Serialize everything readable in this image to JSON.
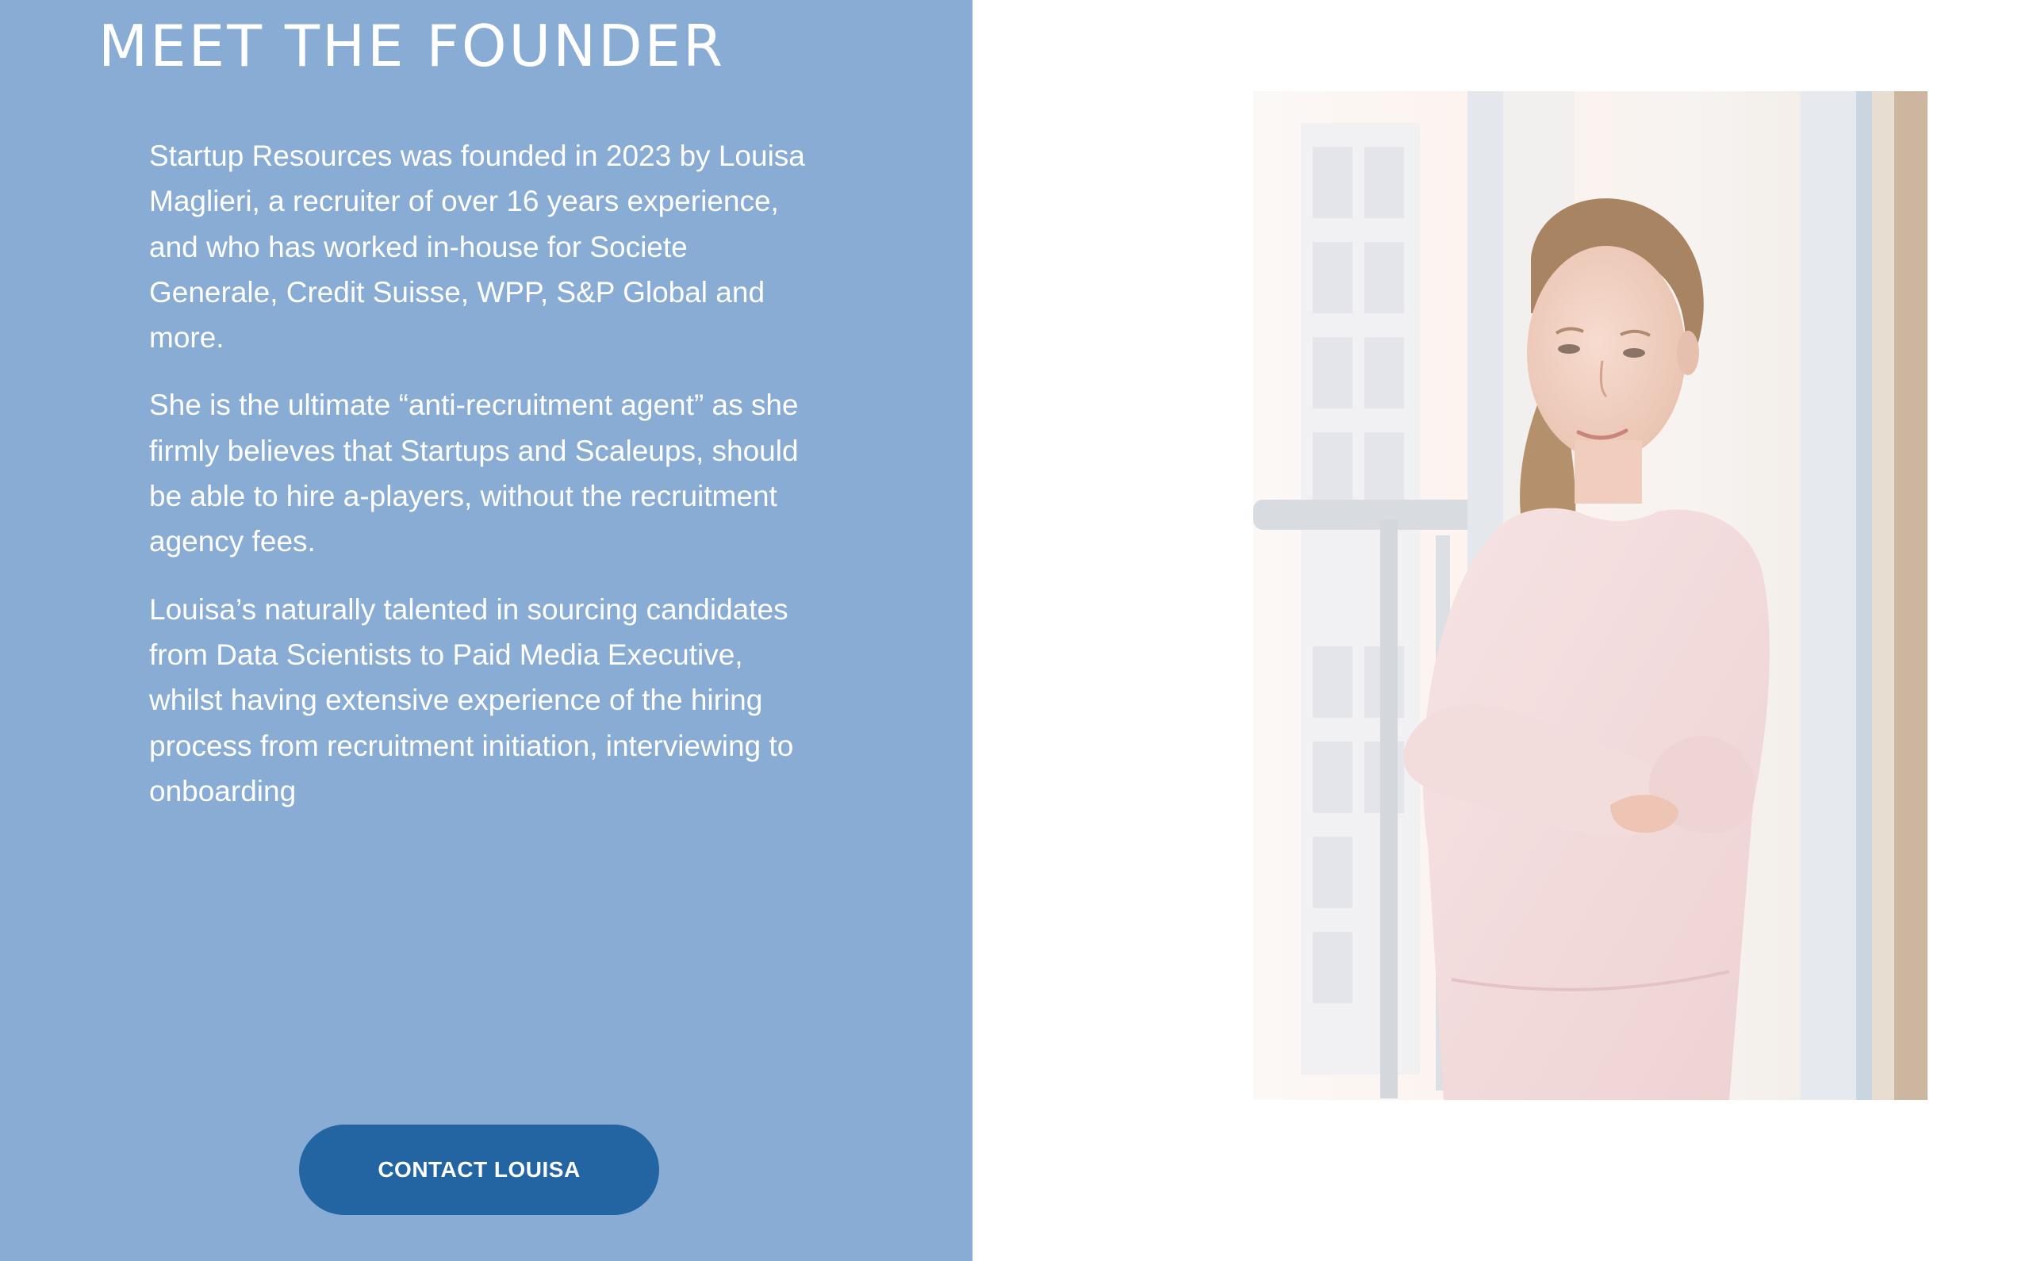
{
  "founder_section": {
    "heading": "MEET THE FOUNDER",
    "paragraphs": [
      "Startup Resources was founded in 2023 by Louisa Maglieri, a recruiter of over 16 years experience, and who has worked in-house for Societe Generale, Credit Suisse, WPP, S&P Global and more.",
      "She is the ultimate “anti-recruitment agent” as she firmly believes that Startups and Scaleups, should be able to hire a-players, without the recruitment agency fees.",
      "Louisa’s naturally talented in sourcing candidates from Data Scientists to Paid Media Executive, whilst having extensive experience of the hiring process from recruitment initiation, interviewing to onboarding"
    ],
    "contact_button_label": "CONTACT LOUISA"
  },
  "colors": {
    "panel_background": "#88acd3",
    "button_background": "#2365a3",
    "text": "#ffffff"
  }
}
